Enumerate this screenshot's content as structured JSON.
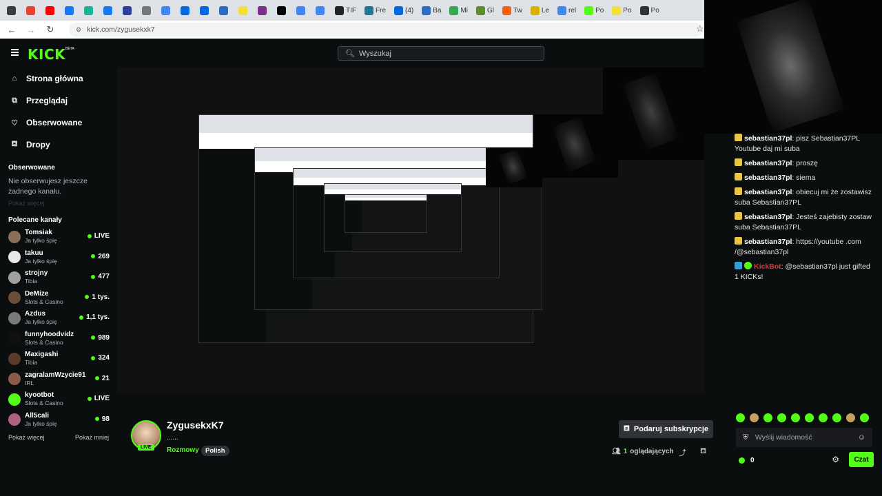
{
  "browser": {
    "url": "kick.com/zygusekxk7",
    "bookmarks": [
      {
        "label": "",
        "color": "#3c3c3c"
      },
      {
        "label": "",
        "color": "#ea4335"
      },
      {
        "label": "",
        "color": "#ff0000"
      },
      {
        "label": "",
        "color": "#1877f2"
      },
      {
        "label": "",
        "color": "#1ab394"
      },
      {
        "label": "",
        "color": "#1877f2"
      },
      {
        "label": "",
        "color": "#2d3f9e"
      },
      {
        "label": "",
        "color": "#777777"
      },
      {
        "label": "",
        "color": "#4285f4"
      },
      {
        "label": "",
        "color": "#0668e1"
      },
      {
        "label": "",
        "color": "#0668e1"
      },
      {
        "label": "",
        "color": "#2d6bc4"
      },
      {
        "label": "",
        "color": "#f0e03a"
      },
      {
        "label": "",
        "color": "#7a2f8a"
      },
      {
        "label": "",
        "color": "#000000"
      },
      {
        "label": "",
        "color": "#4285f4"
      },
      {
        "label": "",
        "color": "#4285f4"
      },
      {
        "label": "TIF",
        "color": "#222222"
      },
      {
        "label": "Fre",
        "color": "#21759b"
      },
      {
        "label": "(4)",
        "color": "#0668e1"
      },
      {
        "label": "Ba",
        "color": "#2d6bc4"
      },
      {
        "label": "Mi",
        "color": "#34a853"
      },
      {
        "label": "Gl",
        "color": "#5a8f29"
      },
      {
        "label": "Tw",
        "color": "#f56400"
      },
      {
        "label": "Le",
        "color": "#d9b300"
      },
      {
        "label": "rel",
        "color": "#4285f4"
      },
      {
        "label": "Po",
        "color": "#53fc18"
      },
      {
        "label": "Po",
        "color": "#f0e03a"
      },
      {
        "label": "Po",
        "color": "#333333"
      }
    ]
  },
  "header": {
    "logo": "KICK",
    "beta": "BETA",
    "search_placeholder": "Wyszukaj"
  },
  "sidebar": {
    "nav": [
      {
        "label": "Strona główna",
        "icon": "home-icon",
        "glyph": "⌂"
      },
      {
        "label": "Przeglądaj",
        "icon": "browse-icon",
        "glyph": "⧉"
      },
      {
        "label": "Obserwowane",
        "icon": "heart-icon",
        "glyph": "♡"
      },
      {
        "label": "Dropy",
        "icon": "gift-icon",
        "glyph": "⛾"
      }
    ],
    "followed_title": "Obserwowane",
    "followed_empty": "Nie obserwujesz jeszcze żadnego kanału.",
    "followed_more": "Pokaż więcej",
    "recommended_title": "Polecane kanały",
    "channels": [
      {
        "name": "Tomsiak",
        "category": "Ja tylko śpię",
        "count": "LIVE",
        "color": "#8b6f5a"
      },
      {
        "name": "takuu",
        "category": "Ja tylko śpię",
        "count": "269",
        "color": "#e8e8e8"
      },
      {
        "name": "strojny",
        "category": "Tibia",
        "count": "477",
        "color": "#a0a0a0"
      },
      {
        "name": "DeMize",
        "category": "Slots & Casino",
        "count": "1 tys.",
        "color": "#6b4e3a"
      },
      {
        "name": "Azdus",
        "category": "Ja tylko śpię",
        "count": "1,1 tys.",
        "color": "#7a7a7a"
      },
      {
        "name": "funnyhoodvidz",
        "category": "Slots & Casino",
        "count": "989",
        "color": "#111111"
      },
      {
        "name": "Maxigashi",
        "category": "Tibia",
        "count": "324",
        "color": "#5a3a2a"
      },
      {
        "name": "zagralamWzycie91",
        "category": "IRL",
        "count": "21",
        "color": "#8a5a4a"
      },
      {
        "name": "kyootbot",
        "category": "Slots & Casino",
        "count": "LIVE",
        "color": "#53fc18"
      },
      {
        "name": "All5cali",
        "category": "Ja tylko śpię",
        "count": "98",
        "color": "#b06080"
      }
    ],
    "show_more": "Pokaż więcej",
    "show_less": "Pokaż mniej"
  },
  "chat": {
    "messages": [
      {
        "user": "sebastian37pl",
        "text": "pisz Sebastian37PL Youtube daj mi suba",
        "bot": false
      },
      {
        "user": "sebastian37pl",
        "text": "proszę",
        "bot": false
      },
      {
        "user": "sebastian37pl",
        "text": "siema",
        "bot": false
      },
      {
        "user": "sebastian37pl",
        "text": "obiecuj mi że zostawisz suba Sebastian37PL",
        "bot": false
      },
      {
        "user": "sebastian37pl",
        "text": "Jesteś zajebisty zostaw suba Sebastian37PL",
        "bot": false
      },
      {
        "user": "sebastian37pl",
        "text": "https://youtube .com /@sebastian37pl",
        "bot": false
      },
      {
        "user": "KickBot",
        "text": "@sebastian37pl just gifted 1 KICKs!",
        "bot": true
      }
    ],
    "input_placeholder": "Wyślij wiadomość",
    "points": "0",
    "send_label": "Czat"
  },
  "stream": {
    "name": "ZygusekxK7",
    "title": "......",
    "category": "Rozmowy",
    "tag": "Polish",
    "live": "LIVE",
    "subscribe_label": "Podaruj subskrypcje",
    "viewers_count": "1",
    "viewers_label": "oglądających"
  },
  "colors": {
    "accent": "#53fc18",
    "background": "#0b0e0f"
  }
}
